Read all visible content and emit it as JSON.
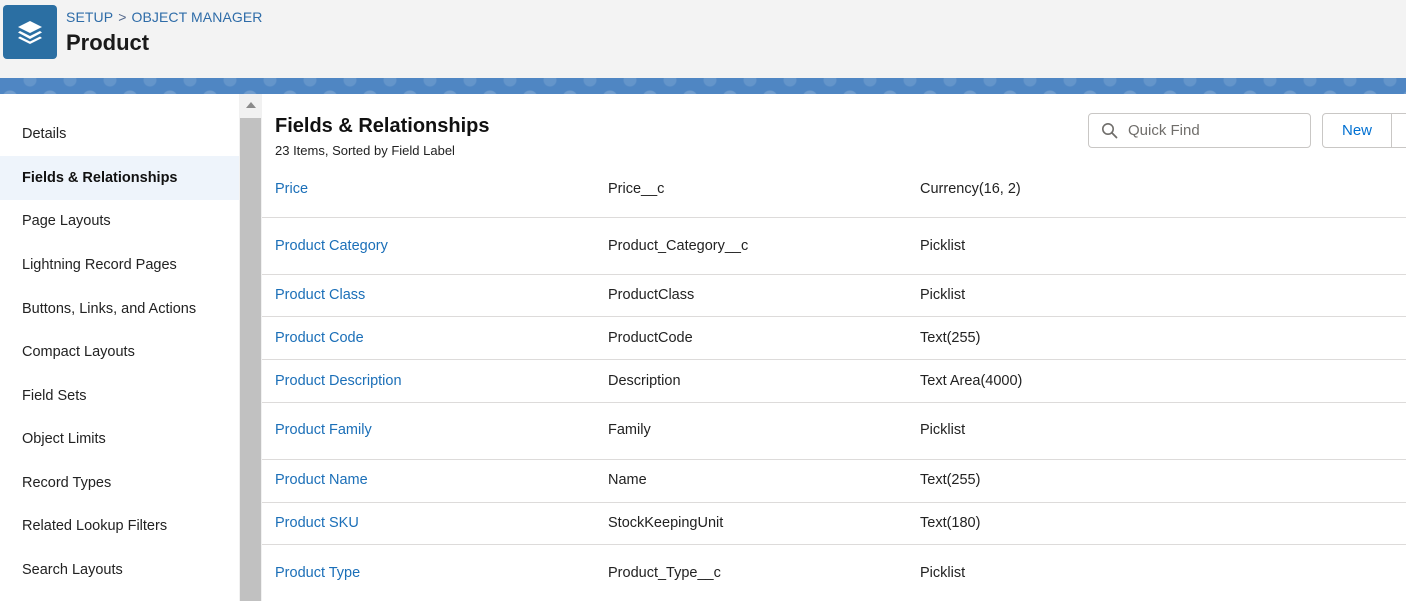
{
  "header": {
    "breadcrumb": [
      "SETUP",
      "OBJECT MANAGER"
    ],
    "breadcrumb_sep": ">",
    "title": "Product",
    "icon": "layers-icon",
    "icon_color": "#2b6fa3"
  },
  "sidebar": {
    "items": [
      {
        "label": "Details"
      },
      {
        "label": "Fields & Relationships",
        "active": true
      },
      {
        "label": "Page Layouts"
      },
      {
        "label": "Lightning Record Pages"
      },
      {
        "label": "Buttons, Links, and Actions"
      },
      {
        "label": "Compact Layouts"
      },
      {
        "label": "Field Sets"
      },
      {
        "label": "Object Limits"
      },
      {
        "label": "Record Types"
      },
      {
        "label": "Related Lookup Filters"
      },
      {
        "label": "Search Layouts"
      }
    ]
  },
  "main": {
    "title": "Fields & Relationships",
    "subtitle": "23 Items, Sorted by Field Label",
    "search_placeholder": "Quick Find",
    "new_label": "New",
    "rows": [
      {
        "label": "Price",
        "api": "Price__c",
        "type": "Currency(16, 2)"
      },
      {
        "label": "Product Category",
        "api": "Product_Category__c",
        "type": "Picklist"
      },
      {
        "label": "Product Class",
        "api": "ProductClass",
        "type": "Picklist"
      },
      {
        "label": "Product Code",
        "api": "ProductCode",
        "type": "Text(255)"
      },
      {
        "label": "Product Description",
        "api": "Description",
        "type": "Text Area(4000)"
      },
      {
        "label": "Product Family",
        "api": "Family",
        "type": "Picklist"
      },
      {
        "label": "Product Name",
        "api": "Name",
        "type": "Text(255)"
      },
      {
        "label": "Product SKU",
        "api": "StockKeepingUnit",
        "type": "Text(180)"
      },
      {
        "label": "Product Type",
        "api": "Product_Type__c",
        "type": "Picklist"
      }
    ]
  },
  "colors": {
    "link": "#1b6fb8",
    "band": "#4f86c3",
    "active_bg": "#eef4fb"
  }
}
